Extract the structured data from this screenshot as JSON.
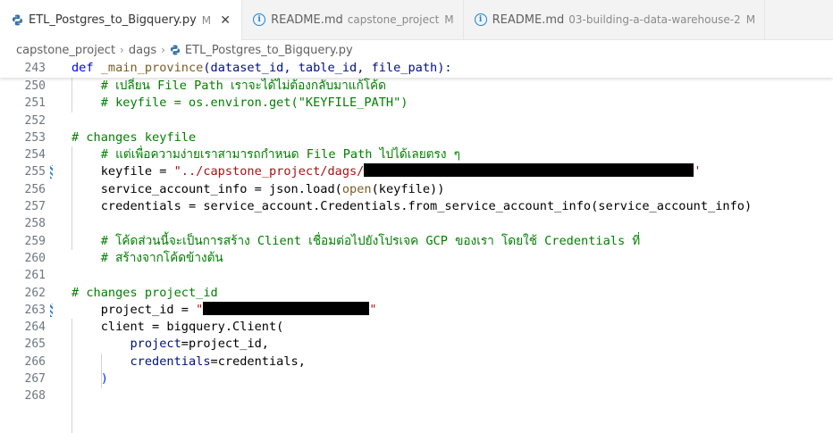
{
  "tabs": [
    {
      "label": "ETL_Postgres_to_Bigquery.py",
      "modified": "M",
      "close": "✕",
      "icon": "python-icon",
      "active": true
    },
    {
      "label": "README.md",
      "description": "capstone_project",
      "modified": "M",
      "icon": "info-icon"
    },
    {
      "label": "README.md",
      "description": "03-building-a-data-warehouse-2",
      "modified": "M",
      "icon": "info-icon"
    }
  ],
  "breadcrumb": {
    "items": [
      "capstone_project",
      "dags",
      "ETL_Postgres_to_Bigquery.py"
    ],
    "separator": "›"
  },
  "sticky": {
    "line": "243",
    "def": "def",
    "func": "_main_province",
    "params": "(dataset_id, table_id, file_path):"
  },
  "lines": {
    "n250": "250",
    "n251": "251",
    "n252": "252",
    "n253": "253",
    "n254": "254",
    "n255": "255",
    "n256": "256",
    "n257": "257",
    "n258": "258",
    "n259": "259",
    "n260": "260",
    "n261": "261",
    "n262": "262",
    "n263": "263",
    "n264": "264",
    "n265": "265",
    "n266": "266",
    "n267": "267",
    "n268": "268",
    "l250": "    # เปลี่ยน File Path เราจะได้ไม่ต้องกลับมาแก้โค้ด",
    "l251": "    # keyfile = os.environ.get(\"KEYFILE_PATH\")",
    "l253": "# changes keyfile",
    "l254": "    # แต่เพื่อความง่ายเราสามารถกำหนด File Path ไปได้เลยตรง ๆ",
    "l255_a": "    keyfile = ",
    "l255_b": "\"../capstone_project/dags/",
    "l255_c": "'",
    "l256_a": "    service_account_info = json.load(",
    "l256_b": "open",
    "l256_c": "(keyfile))",
    "l257": "    credentials = service_account.Credentials.from_service_account_info(service_account_info)",
    "l259": "    # โค้ดส่วนนี้จะเป็นการสร้าง Client เชื่อมต่อไปยังโปรเจค GCP ของเรา โดยใช้ Credentials ที่",
    "l260": "    # สร้างจากโค้ดข้างต้น",
    "l262": "# changes project_id",
    "l263_a": "    project_id = ",
    "l263_b": "\"",
    "l263_c": "\"",
    "l264": "    client = bigquery.Client(",
    "l265_a": "        ",
    "l265_b": "project",
    "l265_c": "=project_id,",
    "l266_a": "        ",
    "l266_b": "credentials",
    "l266_c": "=credentials,",
    "l267_a": "    ",
    "l267_b": ")"
  },
  "colors": {
    "keyword": "#0000ff",
    "function": "#795e26",
    "string": "#a31515",
    "comment": "#008000",
    "param": "#001080"
  }
}
